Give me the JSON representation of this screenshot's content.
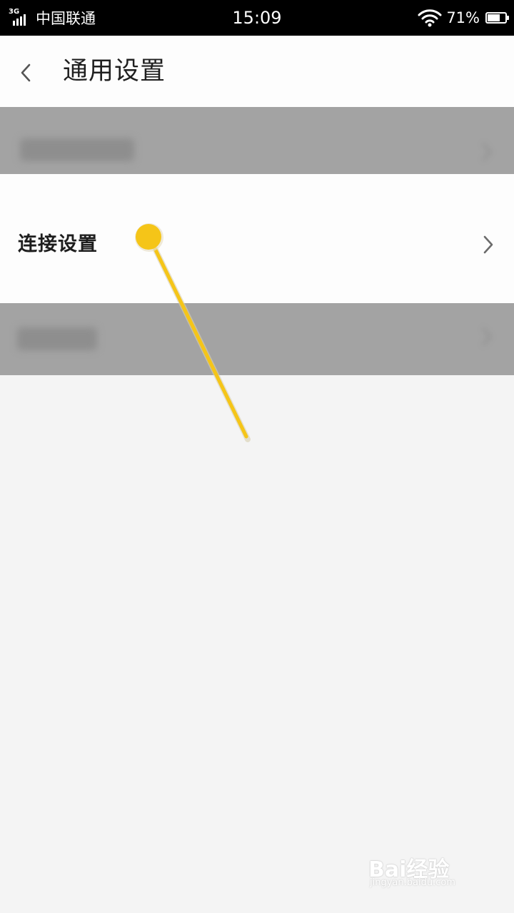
{
  "status_bar": {
    "network_type": "3G",
    "carrier": "中国联通",
    "time": "15:09",
    "battery_percent_text": "71%",
    "battery_level": 0.71
  },
  "header": {
    "back_icon": "chevron-left-icon",
    "title": "通用设置"
  },
  "settings": {
    "items": [
      {
        "label": "",
        "obscured": true,
        "icon": "chevron-right-icon"
      },
      {
        "label": "连接设置",
        "obscured": false,
        "icon": "chevron-right-icon"
      },
      {
        "label": "",
        "obscured": true,
        "icon": "chevron-right-icon"
      }
    ]
  },
  "annotation": {
    "color": "#f5c518",
    "icon": "pointer-marker-icon"
  },
  "watermark": {
    "brand": "Bai经验",
    "url": "jingyan.baidu.com"
  },
  "colors": {
    "status_bar_bg": "#000000",
    "page_bg": "#f4f4f4",
    "dim_row_bg": "#a3a3a3",
    "accent_marker": "#f5c518"
  }
}
